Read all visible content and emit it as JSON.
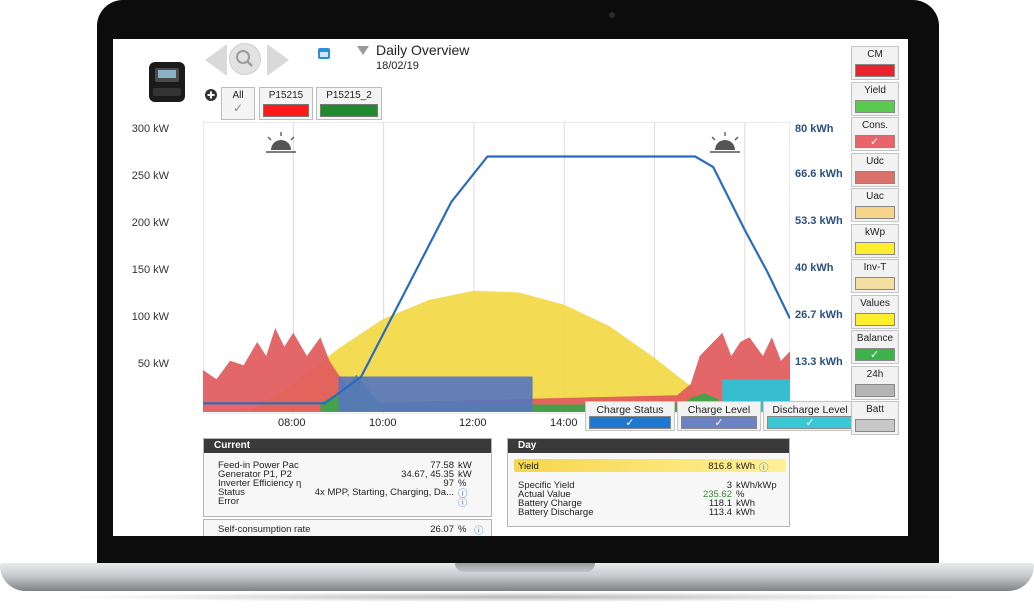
{
  "header": {
    "title": "Daily Overview",
    "date": "18/02/19"
  },
  "devices": {
    "all_label": "All",
    "items": [
      {
        "label": "P15215",
        "color": "#ff1a1a"
      },
      {
        "label": "P15215_2",
        "color": "#1f8b2e"
      }
    ]
  },
  "right_panel": [
    {
      "label": "CM",
      "color": "#e8232a"
    },
    {
      "label": "Yield",
      "color": "#59c94f"
    },
    {
      "label": "Cons.",
      "color": "#e8646a",
      "checked": true
    },
    {
      "label": "Udc",
      "color": "#d9716a"
    },
    {
      "label": "Uac",
      "color": "#f6d58a"
    },
    {
      "label": "kWp",
      "color": "#ffee2e"
    },
    {
      "label": "Inv-T",
      "color": "#f5dfa2"
    },
    {
      "label": "Values",
      "color": "#ffee2e"
    },
    {
      "label": "Balance",
      "color": "#3db14a",
      "checked": true
    },
    {
      "label": "24h",
      "color": "#b5b5b5"
    },
    {
      "label": "Batt",
      "color": "#c8c8c8"
    }
  ],
  "chart_legend": [
    {
      "label": "Charge Status",
      "color": "#1f78cf"
    },
    {
      "label": "Charge Level",
      "color": "#6b82c4"
    },
    {
      "label": "Discharge Level",
      "color": "#3ac7d6"
    }
  ],
  "chart_data": {
    "type": "area",
    "y_left_label": "kW",
    "y_left_ticks": [
      "300 kW",
      "250 kW",
      "200 kW",
      "150 kW",
      "100 kW",
      "50 kW"
    ],
    "y_left_range": [
      0,
      300
    ],
    "y_right_ticks": [
      "80 kWh",
      "66.6 kWh",
      "53.3 kWh",
      "40 kWh",
      "26.7 kWh",
      "13.3 kWh"
    ],
    "y_right_range": [
      0,
      80
    ],
    "x_ticks": [
      "08:00",
      "10:00",
      "12:00",
      "14:00"
    ],
    "x_range_hours": [
      6,
      19
    ],
    "series": [
      {
        "name": "Yield",
        "color": "#f2d94a",
        "points": [
          [
            7.0,
            0
          ],
          [
            8.0,
            30
          ],
          [
            9.0,
            68
          ],
          [
            10.0,
            100
          ],
          [
            11.0,
            120
          ],
          [
            12.0,
            130
          ],
          [
            13.0,
            128
          ],
          [
            14.0,
            115
          ],
          [
            15.0,
            92
          ],
          [
            16.0,
            58
          ],
          [
            17.0,
            20
          ],
          [
            17.5,
            0
          ]
        ]
      },
      {
        "name": "Consumption",
        "color": "#e15a5c",
        "points": [
          [
            6.0,
            0
          ],
          [
            6.0,
            45
          ],
          [
            6.3,
            35
          ],
          [
            6.6,
            55
          ],
          [
            6.9,
            50
          ],
          [
            7.2,
            75
          ],
          [
            7.4,
            60
          ],
          [
            7.6,
            90
          ],
          [
            7.8,
            70
          ],
          [
            8.0,
            85
          ],
          [
            8.3,
            60
          ],
          [
            8.6,
            80
          ],
          [
            8.8,
            55
          ],
          [
            9.0,
            40
          ],
          [
            9.3,
            25
          ],
          [
            9.6,
            10
          ],
          [
            16.5,
            18
          ],
          [
            16.8,
            30
          ],
          [
            17.0,
            60
          ],
          [
            17.2,
            70
          ],
          [
            17.5,
            85
          ],
          [
            17.7,
            60
          ],
          [
            17.9,
            75
          ],
          [
            18.1,
            80
          ],
          [
            18.4,
            60
          ],
          [
            18.6,
            80
          ],
          [
            18.8,
            55
          ],
          [
            19.0,
            65
          ],
          [
            19.0,
            0
          ]
        ]
      },
      {
        "name": "Balance",
        "color": "#3aa64a",
        "points": [
          [
            8.6,
            0
          ],
          [
            8.6,
            10
          ],
          [
            9.0,
            20
          ],
          [
            9.4,
            40
          ],
          [
            9.8,
            15
          ],
          [
            10.0,
            8
          ],
          [
            16.6,
            8
          ],
          [
            16.8,
            15
          ],
          [
            17.1,
            20
          ],
          [
            17.4,
            14
          ],
          [
            17.5,
            0
          ]
        ]
      },
      {
        "name": "Charge Level",
        "color": "#5877bc",
        "points": [
          [
            9.0,
            0
          ],
          [
            9.0,
            38
          ],
          [
            13.3,
            38
          ],
          [
            13.3,
            0
          ]
        ]
      },
      {
        "name": "Discharge Level",
        "color": "#27c4d8",
        "points": [
          [
            17.5,
            0
          ],
          [
            17.5,
            35
          ],
          [
            19.0,
            35
          ],
          [
            19.0,
            0
          ]
        ]
      },
      {
        "name": "Charge Status",
        "color": "#2a6bc0",
        "axis": "right",
        "points": [
          [
            6.0,
            2.5
          ],
          [
            8.7,
            2.5
          ],
          [
            9.5,
            10
          ],
          [
            10.5,
            35
          ],
          [
            11.5,
            60
          ],
          [
            12.3,
            73
          ],
          [
            13.0,
            73
          ],
          [
            16.9,
            73
          ],
          [
            17.3,
            70
          ],
          [
            18.0,
            52
          ],
          [
            18.5,
            40
          ],
          [
            19.0,
            26.7
          ]
        ]
      }
    ]
  },
  "current_panel": {
    "title": "Current",
    "rows": [
      {
        "label": "Feed-in Power Pac",
        "value": "77.58",
        "unit": "kW"
      },
      {
        "label": "Generator P1, P2",
        "value": "34.67, 45.35",
        "unit": "kW"
      },
      {
        "label": "Inverter Efficiency η",
        "value": "97",
        "unit": "%"
      },
      {
        "label": "Status",
        "value": "4x MPP, Starting, Charging, Da...",
        "unit": ""
      },
      {
        "label": "Error",
        "value": "",
        "unit": ""
      }
    ],
    "self_consumption_label": "Self-consumption rate",
    "self_consumption_value": "26.07",
    "self_consumption_unit": "%"
  },
  "day_panel": {
    "title": "Day",
    "yield_label": "Yield",
    "yield_value": "816.8",
    "yield_unit": "kWh",
    "rows": [
      {
        "label": "Specific Yield",
        "value": "3",
        "unit": "kWh/kWp"
      },
      {
        "label": "Actual Value",
        "value": "235.62",
        "unit": "%",
        "color": "#2f8a2f"
      },
      {
        "label": "Battery Charge",
        "value": "118.1",
        "unit": "kWh"
      },
      {
        "label": "Battery Discharge",
        "value": "113.4",
        "unit": "kWh"
      }
    ]
  }
}
